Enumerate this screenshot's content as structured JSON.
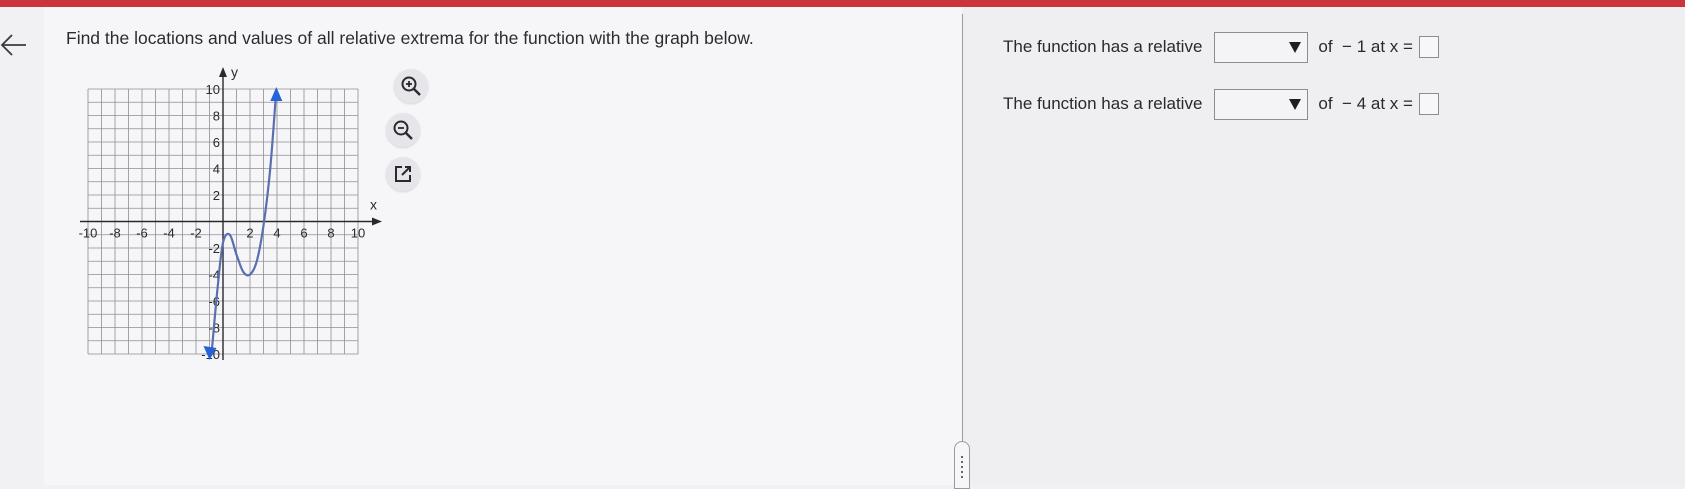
{
  "question": {
    "text": "Find the locations and values of all relative extrema for the function with the graph below."
  },
  "graph": {
    "x_axis_label": "x",
    "y_axis_label": "y",
    "x_ticks": [
      "-10",
      "-8",
      "-6",
      "-4",
      "-2",
      "2",
      "4",
      "6",
      "8",
      "10"
    ],
    "y_ticks": [
      "10",
      "8",
      "6",
      "4",
      "2",
      "-2",
      "-4",
      "-6",
      "-8",
      "-10"
    ],
    "x_range": [
      -10,
      10
    ],
    "y_range": [
      -10,
      10
    ],
    "grid": true,
    "curve_color": "#5a6fb0",
    "arrow_color": "#2563d8",
    "curve_points": [
      [
        -0.85,
        -10
      ],
      [
        -0.4,
        -5
      ],
      [
        0,
        -1.6
      ],
      [
        0.5,
        -1
      ],
      [
        1,
        -2.5
      ],
      [
        1.5,
        -3.8
      ],
      [
        2,
        -4
      ],
      [
        2.5,
        -3
      ],
      [
        3,
        -0.3
      ],
      [
        3.5,
        4
      ],
      [
        3.95,
        10
      ]
    ]
  },
  "tools": {
    "zoom_in": "zoom-in-icon",
    "zoom_out": "zoom-out-icon",
    "popout": "external-link-icon"
  },
  "answers": [
    {
      "label": "The function has a relative",
      "dropdown_value": "",
      "of_text": "of",
      "value_text": "− 1",
      "at_text": "at x =",
      "x_value": ""
    },
    {
      "label": "The function has a relative",
      "dropdown_value": "",
      "of_text": "of",
      "value_text": "− 4",
      "at_text": "at x =",
      "x_value": ""
    }
  ],
  "colors": {
    "top_bar": "#c9343d",
    "background": "#f6f6f8"
  }
}
